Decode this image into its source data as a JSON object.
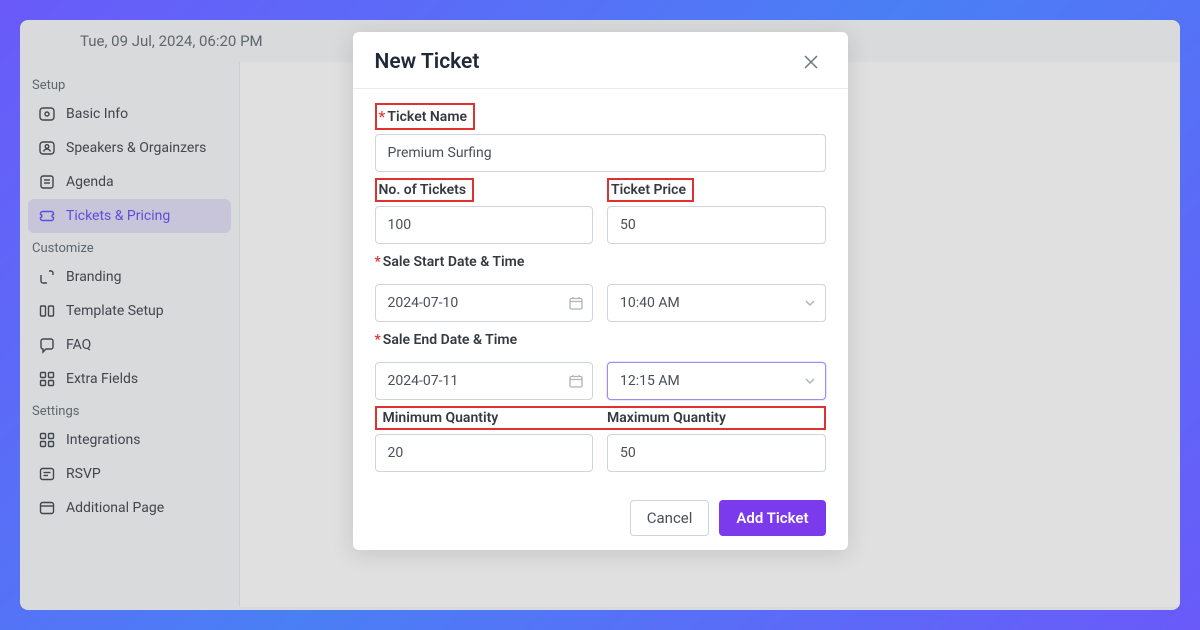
{
  "header": {
    "date": "Tue, 09 Jul, 2024, 06:20 PM"
  },
  "sidebar": {
    "sections": [
      {
        "label": "Setup",
        "items": [
          {
            "icon": "info-icon",
            "label": "Basic Info"
          },
          {
            "icon": "users-icon",
            "label": "Speakers & Orgainzers"
          },
          {
            "icon": "note-icon",
            "label": "Agenda"
          },
          {
            "icon": "ticket-icon",
            "label": "Tickets & Pricing",
            "active": true
          }
        ]
      },
      {
        "label": "Customize",
        "items": [
          {
            "icon": "brand-icon",
            "label": "Branding"
          },
          {
            "icon": "template-icon",
            "label": "Template Setup"
          },
          {
            "icon": "faq-icon",
            "label": "FAQ"
          },
          {
            "icon": "fields-icon",
            "label": "Extra Fields"
          }
        ]
      },
      {
        "label": "Settings",
        "items": [
          {
            "icon": "integr-icon",
            "label": "Integrations"
          },
          {
            "icon": "rsvp-icon",
            "label": "RSVP"
          },
          {
            "icon": "page-icon",
            "label": "Additional Page"
          }
        ]
      }
    ]
  },
  "modal": {
    "title": "New Ticket",
    "labels": {
      "ticket_name": "Ticket Name",
      "no_tickets": "No. of Tickets",
      "ticket_price": "Ticket Price",
      "sale_start": "Sale Start Date & Time",
      "sale_end": "Sale End Date & Time",
      "min_qty": "Minimum Quantity",
      "max_qty": "Maximum Quantity"
    },
    "values": {
      "ticket_name": "Premium Surfing",
      "no_tickets": "100",
      "ticket_price": "50",
      "sale_start_date": "2024-07-10",
      "sale_start_time": "10:40 AM",
      "sale_end_date": "2024-07-11",
      "sale_end_time": "12:15 AM",
      "min_qty": "20",
      "max_qty": "50"
    },
    "actions": {
      "cancel": "Cancel",
      "submit": "Add Ticket"
    }
  }
}
